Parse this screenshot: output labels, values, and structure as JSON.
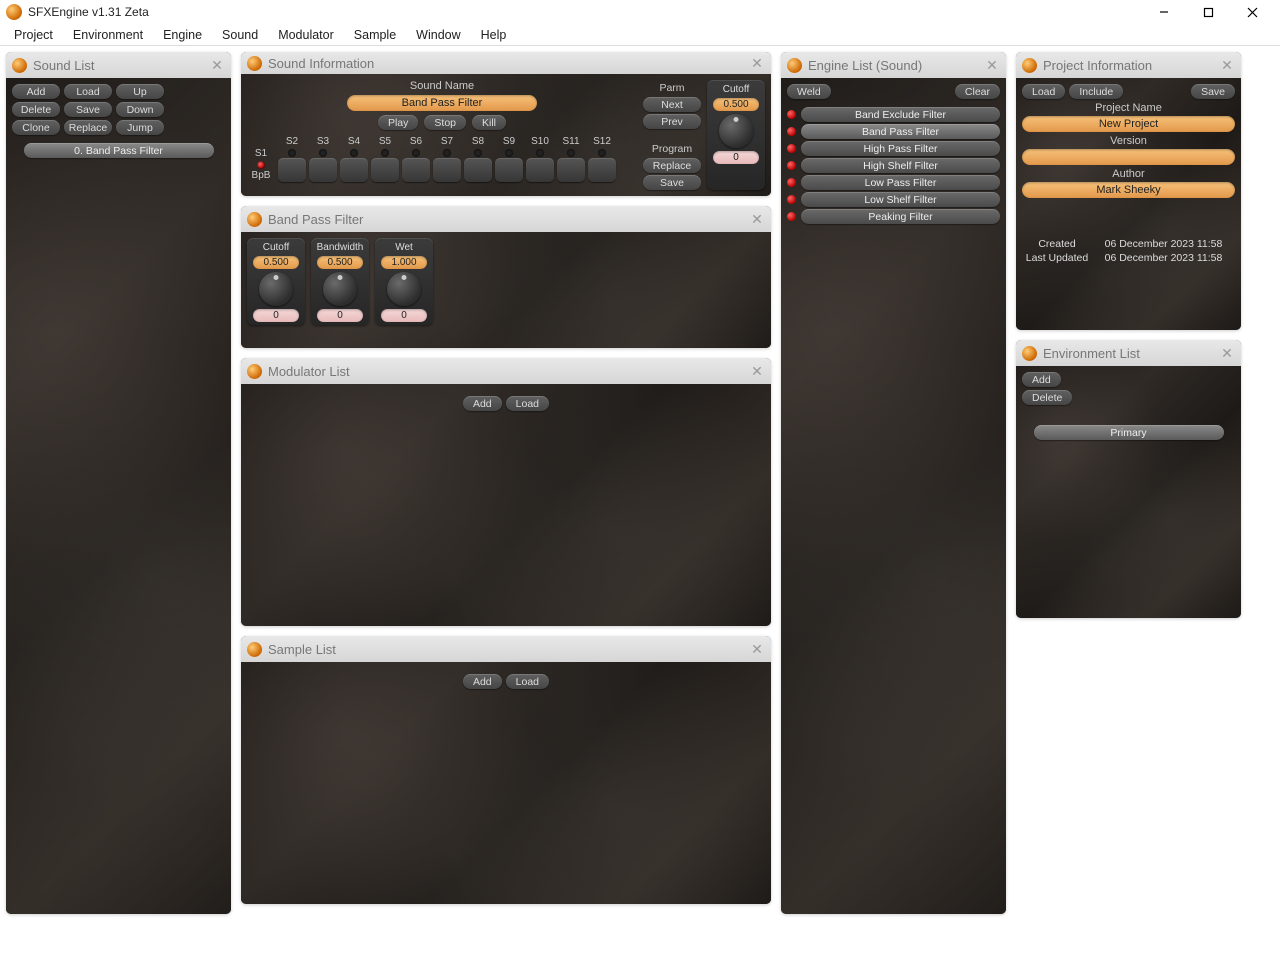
{
  "app": {
    "title": "SFXEngine v1.31 Zeta"
  },
  "menus": [
    "Project",
    "Environment",
    "Engine",
    "Sound",
    "Modulator",
    "Sample",
    "Window",
    "Help"
  ],
  "soundList": {
    "title": "Sound List",
    "buttons": {
      "r1": [
        "Add",
        "Load",
        "Up"
      ],
      "r2": [
        "Delete",
        "Save",
        "Down"
      ],
      "r3": [
        "Clone",
        "Replace",
        "Jump"
      ]
    },
    "items": [
      "0. Band Pass Filter"
    ]
  },
  "soundInfo": {
    "title": "Sound Information",
    "nameLabel": "Sound Name",
    "name": "Band Pass Filter",
    "transport": [
      "Play",
      "Stop",
      "Kill"
    ],
    "slots": [
      "S1",
      "S2",
      "S3",
      "S4",
      "S5",
      "S6",
      "S7",
      "S8",
      "S9",
      "S10",
      "S11",
      "S12"
    ],
    "bpb": "BpB",
    "parm": {
      "label": "Parm",
      "next": "Next",
      "prev": "Prev"
    },
    "program": {
      "label": "Program",
      "replace": "Replace",
      "save": "Save"
    },
    "cutoffKnob": {
      "label": "Cutoff",
      "value": "0.500",
      "index": "0"
    }
  },
  "filterPanel": {
    "title": "Band Pass Filter",
    "knobs": [
      {
        "label": "Cutoff",
        "value": "0.500",
        "index": "0"
      },
      {
        "label": "Bandwidth",
        "value": "0.500",
        "index": "0"
      },
      {
        "label": "Wet",
        "value": "1.000",
        "index": "0"
      }
    ]
  },
  "modList": {
    "title": "Modulator List",
    "buttons": [
      "Add",
      "Load"
    ]
  },
  "sampleList": {
    "title": "Sample List",
    "buttons": [
      "Add",
      "Load"
    ]
  },
  "engineList": {
    "title": "Engine List (Sound)",
    "weld": "Weld",
    "clear": "Clear",
    "items": [
      "Band Exclude Filter",
      "Band Pass Filter",
      "High Pass Filter",
      "High Shelf Filter",
      "Low Pass Filter",
      "Low Shelf Filter",
      "Peaking Filter"
    ],
    "selectedIndex": 1
  },
  "projInfo": {
    "title": "Project Information",
    "load": "Load",
    "include": "Include",
    "save": "Save",
    "fields": {
      "nameLabel": "Project Name",
      "name": "New Project",
      "versionLabel": "Version",
      "version": "",
      "authorLabel": "Author",
      "author": "Mark Sheeky"
    },
    "createdLabel": "Created",
    "created": "06 December 2023 11:58",
    "updatedLabel": "Last Updated",
    "updated": "06 December 2023 11:58"
  },
  "envList": {
    "title": "Environment List",
    "add": "Add",
    "delete": "Delete",
    "items": [
      "Primary"
    ]
  }
}
